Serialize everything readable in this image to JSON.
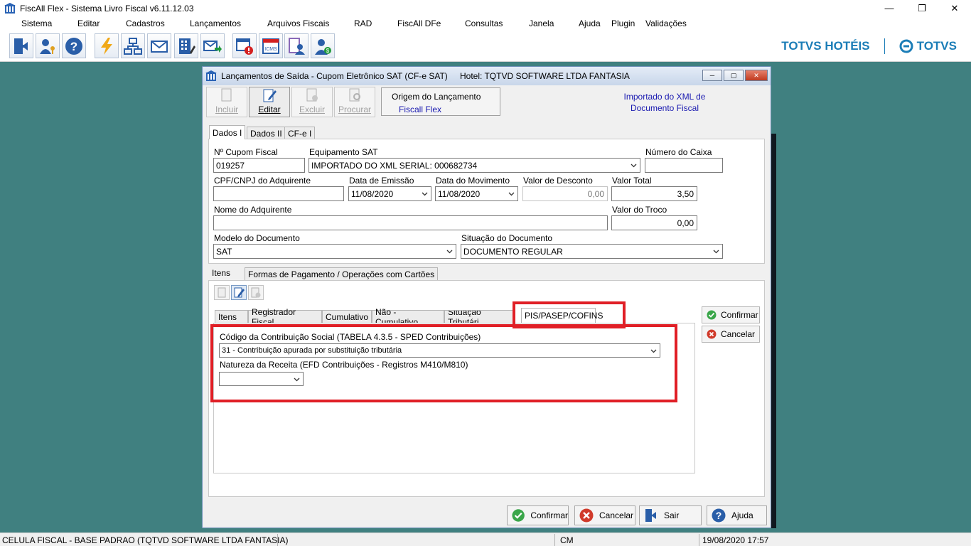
{
  "window": {
    "title": "FiscAll Flex - Sistema Livro Fiscal v6.11.12.03",
    "controls": [
      "minimize",
      "maximize",
      "close"
    ]
  },
  "menu": [
    "Sistema",
    "Editar",
    "Cadastros",
    "Lançamentos",
    "Arquivos Fiscais",
    "RAD",
    "FiscAll DFe",
    "Consultas",
    "Janela",
    "Ajuda",
    "Plugin",
    "Validações"
  ],
  "brand": {
    "left": "TOTVS HOTÉIS",
    "right": "TOTVS"
  },
  "dialog": {
    "title": "Lançamentos de Saída - Cupom Eletrônico SAT (CF-e SAT)",
    "hotel": "Hotel: TQTVD SOFTWARE LTDA FANTASIA",
    "buttons": {
      "incluir": "Incluir",
      "editar": "Editar",
      "excluir": "Excluir",
      "procurar": "Procurar"
    },
    "origem": {
      "label": "Origem do Lançamento",
      "value": "Fiscall Flex"
    },
    "importado_line1": "Importado do XML de",
    "importado_line2": "Documento Fiscal",
    "tabs": [
      "Dados I",
      "Dados II",
      "CF-e I"
    ],
    "fields": {
      "cupom_label": "Nº Cupom Fiscal",
      "cupom_value": "019257",
      "equip_label": "Equipamento SAT",
      "equip_value": "IMPORTADO DO XML SERIAL: 000682734",
      "caixa_label": "Número do Caixa",
      "caixa_value": "",
      "cpf_label": "CPF/CNPJ do Adquirente",
      "cpf_value": "",
      "emissao_label": "Data de Emissão",
      "emissao_value": "11/08/2020",
      "movimento_label": "Data do Movimento",
      "movimento_value": "11/08/2020",
      "desconto_label": "Valor de Desconto",
      "desconto_value": "0,00",
      "total_label": "Valor Total",
      "total_value": "3,50",
      "nome_label": "Nome do Adquirente",
      "nome_value": "",
      "troco_label": "Valor do Troco",
      "troco_value": "0,00",
      "modelo_label": "Modelo do Documento",
      "modelo_value": "SAT",
      "situacao_label": "Situação do Documento",
      "situacao_value": "DOCUMENTO REGULAR"
    },
    "lower_tabs": [
      "Itens",
      "Formas de Pagamento / Operações com Cartões"
    ],
    "item_tabs": [
      "Itens",
      "Registrador Fiscal",
      "Cumulativo",
      "Não - Cumulativo",
      "Situação Tributári",
      "PIS/PASEP/COFINS"
    ],
    "pis": {
      "cst_label": "Código da Contribuição Social (TABELA 4.3.5 - SPED Contribuições)",
      "cst_value": "31 - Contribuição apurada por substituição tributária",
      "natureza_label": "Natureza da Receita (EFD Contribuições - Registros M410/M810)",
      "natureza_value": ""
    },
    "side_buttons": {
      "confirmar": "Confirmar",
      "cancelar": "Cancelar"
    },
    "bottom_buttons": {
      "confirmar": "Confirmar",
      "cancelar": "Cancelar",
      "sair": "Sair",
      "ajuda": "Ajuda"
    }
  },
  "status": {
    "left": "CELULA FISCAL - BASE PADRAO (TQTVD SOFTWARE LTDA FANTASIA)",
    "mid": "CM",
    "right": "19/08/2020 17:57"
  }
}
